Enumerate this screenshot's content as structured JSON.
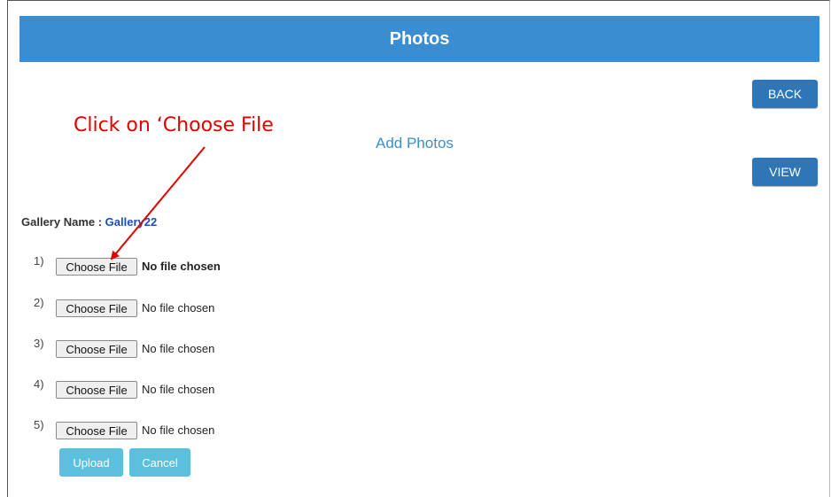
{
  "header": {
    "title": "Photos"
  },
  "nav": {
    "back_label": "BACK",
    "view_label": "VIEW"
  },
  "form": {
    "title": "Add Photos",
    "gallery_label": "Gallery Name : ",
    "gallery_name": "Gallery22",
    "rows": [
      {
        "num": "1)",
        "button": "Choose File",
        "status": "No file chosen"
      },
      {
        "num": "2)",
        "button": "Choose File",
        "status": "No file chosen"
      },
      {
        "num": "3)",
        "button": "Choose File",
        "status": "No file chosen"
      },
      {
        "num": "4)",
        "button": "Choose File",
        "status": "No file chosen"
      },
      {
        "num": "5)",
        "button": "Choose File",
        "status": "No file chosen"
      }
    ],
    "upload_label": "Upload",
    "cancel_label": "Cancel"
  },
  "annotation": {
    "text": "Click on ‘Choose File",
    "color": "#e00000"
  },
  "colors": {
    "header": "#3a8dd0",
    "nav_button": "#2f76b9",
    "action_button": "#5bc0de"
  }
}
